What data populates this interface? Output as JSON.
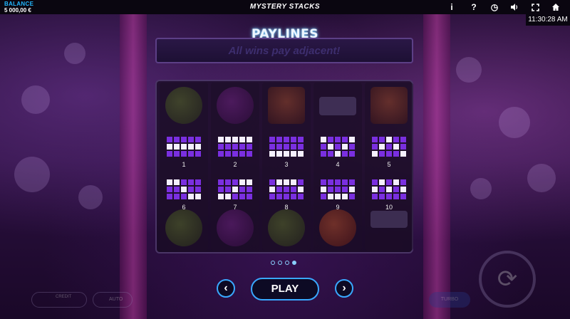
{
  "header": {
    "balance_label": "BALANCE",
    "balance_value": "5 000,00 €",
    "title": "MYSTERY STACKS",
    "icons": [
      "info-icon",
      "help-icon",
      "history-icon",
      "sound-icon",
      "fullscreen-icon",
      "home-icon"
    ],
    "icon_glyphs": [
      "i",
      "?",
      "◷",
      "🔊",
      "⛶",
      "⌂"
    ],
    "clock": "11:30:28 AM"
  },
  "paytable": {
    "title": "PAYLINES",
    "subtitle": "All wins pay adjacent!",
    "paylines": [
      {
        "number": "1",
        "rows": [
          [
            0,
            0,
            0,
            0,
            0
          ],
          [
            1,
            1,
            1,
            1,
            1
          ],
          [
            0,
            0,
            0,
            0,
            0
          ]
        ]
      },
      {
        "number": "2",
        "rows": [
          [
            1,
            1,
            1,
            1,
            1
          ],
          [
            0,
            0,
            0,
            0,
            0
          ],
          [
            0,
            0,
            0,
            0,
            0
          ]
        ]
      },
      {
        "number": "3",
        "rows": [
          [
            0,
            0,
            0,
            0,
            0
          ],
          [
            0,
            0,
            0,
            0,
            0
          ],
          [
            1,
            1,
            1,
            1,
            1
          ]
        ]
      },
      {
        "number": "4",
        "rows": [
          [
            1,
            0,
            0,
            0,
            1
          ],
          [
            0,
            1,
            0,
            1,
            0
          ],
          [
            0,
            0,
            1,
            0,
            0
          ]
        ]
      },
      {
        "number": "5",
        "rows": [
          [
            0,
            0,
            1,
            0,
            0
          ],
          [
            0,
            1,
            0,
            1,
            0
          ],
          [
            1,
            0,
            0,
            0,
            1
          ]
        ]
      },
      {
        "number": "6",
        "rows": [
          [
            1,
            1,
            0,
            0,
            0
          ],
          [
            0,
            0,
            1,
            0,
            0
          ],
          [
            0,
            0,
            0,
            1,
            1
          ]
        ]
      },
      {
        "number": "7",
        "rows": [
          [
            0,
            0,
            0,
            1,
            1
          ],
          [
            0,
            0,
            1,
            0,
            0
          ],
          [
            1,
            1,
            0,
            0,
            0
          ]
        ]
      },
      {
        "number": "8",
        "rows": [
          [
            0,
            1,
            1,
            1,
            0
          ],
          [
            1,
            0,
            0,
            0,
            1
          ],
          [
            0,
            0,
            0,
            0,
            0
          ]
        ]
      },
      {
        "number": "9",
        "rows": [
          [
            0,
            0,
            0,
            0,
            0
          ],
          [
            1,
            0,
            0,
            0,
            1
          ],
          [
            0,
            1,
            1,
            1,
            0
          ]
        ]
      },
      {
        "number": "10",
        "rows": [
          [
            0,
            1,
            0,
            1,
            0
          ],
          [
            1,
            0,
            1,
            0,
            1
          ],
          [
            0,
            0,
            0,
            0,
            0
          ]
        ]
      }
    ],
    "page_dots": 4,
    "active_page": 4
  },
  "controls": {
    "prev_glyph": "‹",
    "next_glyph": "›",
    "play_label": "PLAY",
    "credit_label": "CREDIT",
    "auto_label": "AUTO",
    "turbo_label": "TURBO"
  }
}
